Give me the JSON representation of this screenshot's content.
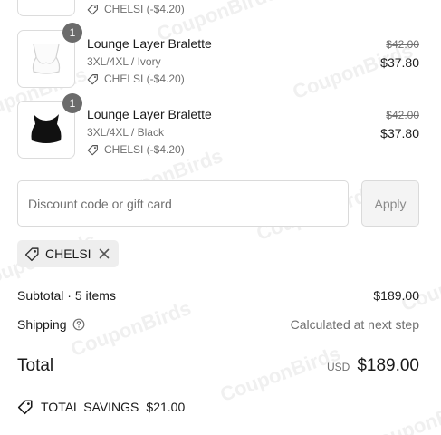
{
  "items": [
    {
      "name": "",
      "variant": "",
      "discount": "CHELSI (-$4.20)",
      "old_price": "",
      "price": "",
      "quantity": ""
    },
    {
      "name": "Lounge Layer Bralette",
      "variant": "3XL/4XL / Ivory",
      "discount": "CHELSI (-$4.20)",
      "old_price": "$42.00",
      "price": "$37.80",
      "quantity": "1"
    },
    {
      "name": "Lounge Layer Bralette",
      "variant": "3XL/4XL / Black",
      "discount": "CHELSI (-$4.20)",
      "old_price": "$42.00",
      "price": "$37.80",
      "quantity": "1"
    }
  ],
  "discount_form": {
    "placeholder": "Discount code or gift card",
    "apply_label": "Apply"
  },
  "applied_code": "CHELSI",
  "summary": {
    "subtotal_label": "Subtotal · 5 items",
    "subtotal_value": "$189.00",
    "shipping_label": "Shipping",
    "shipping_value": "Calculated at next step",
    "total_label": "Total",
    "currency": "USD",
    "total_value": "$189.00",
    "savings_label": "TOTAL SAVINGS",
    "savings_value": "$21.00"
  },
  "watermark": "CouponBirds",
  "icons": {
    "tag": "tag-icon",
    "help": "question-circle-icon",
    "close": "close-icon",
    "savings": "savings-tag-icon"
  }
}
